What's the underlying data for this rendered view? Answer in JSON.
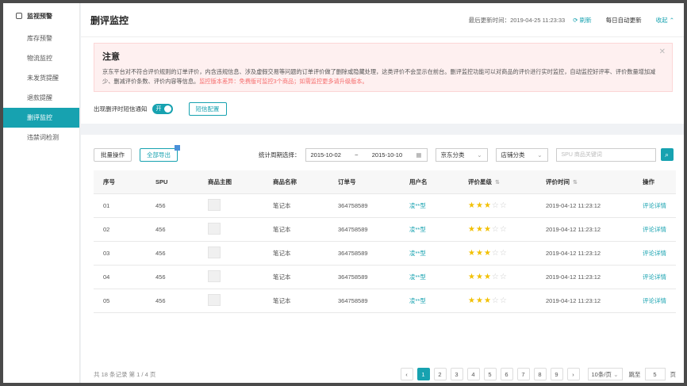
{
  "sidebar": {
    "header": "监视预警",
    "items": [
      {
        "label": "库存预警"
      },
      {
        "label": "物流监控"
      },
      {
        "label": "未发货提醒"
      },
      {
        "label": "退款提醒"
      },
      {
        "label": "删评监控"
      },
      {
        "label": "违禁词检测"
      }
    ],
    "active_index": 4
  },
  "header": {
    "title": "删评监控",
    "last_update_label": "最后更新时间：",
    "last_update": "2019-04-25 11:23:33",
    "refresh": "刷新",
    "auto_update": "每日自动更新",
    "collapse": "收起"
  },
  "notice": {
    "title": "注意",
    "body": "京东平台对不符合评价规则的订单评价，内含违规信息、涉及虚假交易等问题的订单评价做了删除或隐藏处理，这类评价不会显示在前台。删评监控功能可以对商品的评价进行实时监控，自动监控好评率、评价数量增加减少、删减评价条数、评价内容等信息。",
    "warning": "监控版本差异：免费版可监控3个商品；如需监控更多请升级版本。"
  },
  "sms": {
    "label": "出现删评时短信通知",
    "toggle": "开",
    "config": "短信配置"
  },
  "toolbar": {
    "batch": "批量操作",
    "export": "全部导出",
    "period_label": "统计周期选择：",
    "date_start": "2015-10-02",
    "date_sep": "~",
    "date_end": "2015-10-10",
    "jd_category": "京东分类",
    "shop_category": "店铺分类",
    "search_placeholder": "SPU 商品关键词"
  },
  "table": {
    "headers": [
      "序号",
      "SPU",
      "商品主图",
      "商品名称",
      "订单号",
      "用户名",
      "评价星级",
      "评价时间",
      "操作"
    ],
    "rows": [
      {
        "no": "01",
        "spu": "456",
        "name": "笔记本",
        "order": "364758589",
        "user": "凌**型",
        "stars": 3,
        "time": "2019-04-12 11:23:12",
        "action": "评论详情"
      },
      {
        "no": "02",
        "spu": "456",
        "name": "笔记本",
        "order": "364758589",
        "user": "凌**型",
        "stars": 3,
        "time": "2019-04-12 11:23:12",
        "action": "评论详情"
      },
      {
        "no": "03",
        "spu": "456",
        "name": "笔记本",
        "order": "364758589",
        "user": "凌**型",
        "stars": 3,
        "time": "2019-04-12 11:23:12",
        "action": "评论详情"
      },
      {
        "no": "04",
        "spu": "456",
        "name": "笔记本",
        "order": "364758589",
        "user": "凌**型",
        "stars": 3,
        "time": "2019-04-12 11:23:12",
        "action": "评论详情"
      },
      {
        "no": "05",
        "spu": "456",
        "name": "笔记本",
        "order": "364758589",
        "user": "凌**型",
        "stars": 3,
        "time": "2019-04-12 11:23:12",
        "action": "评论详情"
      }
    ]
  },
  "pagination": {
    "summary": "共 18 条记录 第 1 / 4 页",
    "pages": [
      "1",
      "2",
      "3",
      "4",
      "5",
      "6",
      "7",
      "8",
      "9"
    ],
    "current": "1",
    "page_size": "10条/页",
    "jump_label": "跳至",
    "jump_value": "5",
    "unit": "页"
  },
  "colors": {
    "accent": "#17a2b0",
    "warning": "#f56c6c",
    "star": "#f2c000"
  }
}
